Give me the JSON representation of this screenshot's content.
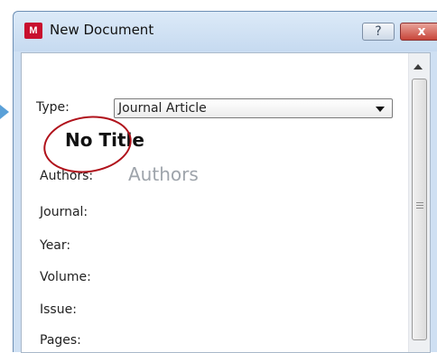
{
  "window": {
    "title": "New Document",
    "app_icon": "mendeley-icon",
    "help_label": "?",
    "close_label": "x"
  },
  "form": {
    "type_label": "Type:",
    "type_value": "Journal Article",
    "doc_title": "No Title",
    "authors_label": "Authors:",
    "authors_placeholder": "Authors",
    "journal_label": "Journal:",
    "year_label": "Year:",
    "volume_label": "Volume:",
    "issue_label": "Issue:",
    "pages_label": "Pages:"
  },
  "colors": {
    "highlight": "#b0121b",
    "accent": "#5aa0d8"
  }
}
